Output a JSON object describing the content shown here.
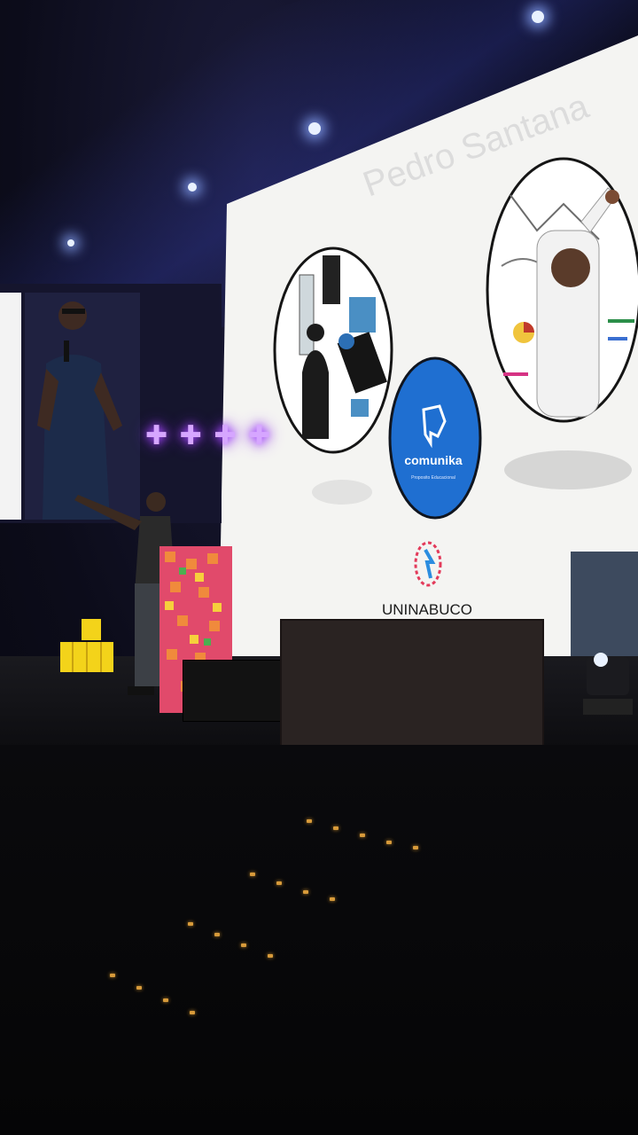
{
  "scene": {
    "description_label": "Conference stage with speaker presenting in front of large screen",
    "slide": {
      "faded_heading": "Pedro Santana",
      "logo_text": "comunika",
      "logo_subtext": "Proposito Educacional",
      "footer_logo": "UNINABUCO"
    },
    "neon_sign": {
      "symbols": "✚ ✚ ✚ ✚"
    },
    "colors": {
      "slide_bg": "#f4f4f2",
      "logo_blue": "#1f6fd1",
      "neon_purple": "#b36cff",
      "neon_gold": "#ffd54a",
      "stage_dark": "#0b0b10"
    }
  }
}
